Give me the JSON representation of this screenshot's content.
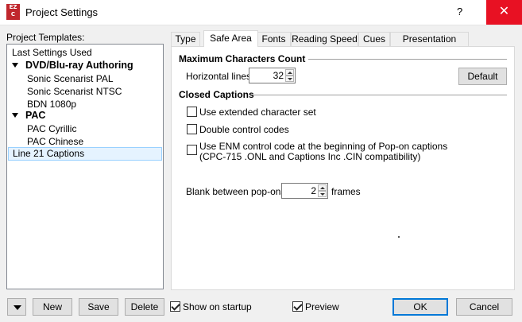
{
  "window": {
    "title": "Project Settings",
    "help_label": "?",
    "close_label": "✕",
    "app_icon_text": "EZ C",
    "close_color": "#e81123"
  },
  "templates": {
    "label": "Project Templates:",
    "items": [
      {
        "label": "Last Settings Used",
        "kind": "item"
      },
      {
        "label": "DVD/Blu-ray Authoring",
        "kind": "group"
      },
      {
        "label": "Sonic Scenarist PAL",
        "kind": "child"
      },
      {
        "label": "Sonic Scenarist NTSC",
        "kind": "child"
      },
      {
        "label": "BDN 1080p",
        "kind": "child"
      },
      {
        "label": "PAC",
        "kind": "group"
      },
      {
        "label": "PAC Cyrillic",
        "kind": "child"
      },
      {
        "label": "PAC Chinese",
        "kind": "child"
      },
      {
        "label": "Line 21 Captions",
        "kind": "selected"
      }
    ]
  },
  "tabs": [
    {
      "label": "Type"
    },
    {
      "label": "Safe Area",
      "active": true
    },
    {
      "label": "Fonts"
    },
    {
      "label": "Reading Speed"
    },
    {
      "label": "Cues"
    },
    {
      "label": "Presentation Style"
    }
  ],
  "max_chars": {
    "section_title": "Maximum Characters Count",
    "horizontal_label": "Horizontal lines:",
    "horizontal_value": "32",
    "default_button": "Default"
  },
  "closed_captions": {
    "section_title": "Closed Captions",
    "extended_charset": "Use extended character set",
    "double_codes": "Double control codes",
    "enm_line1": "Use ENM control code at the beginning of Pop-on captions",
    "enm_line2": "(CPC-715 .ONL and Captions Inc .CIN compatibility)",
    "blank_label": "Blank between pop-ons:",
    "blank_value": "2",
    "blank_unit": "frames"
  },
  "footer": {
    "new": "New",
    "save": "Save",
    "delete": "Delete",
    "show_on_startup": "Show on startup",
    "preview": "Preview",
    "ok": "OK",
    "cancel": "Cancel"
  },
  "colors": {
    "selection_bg": "#e5f3ff",
    "selection_border": "#99d1ff",
    "primary_border": "#0078d7"
  }
}
